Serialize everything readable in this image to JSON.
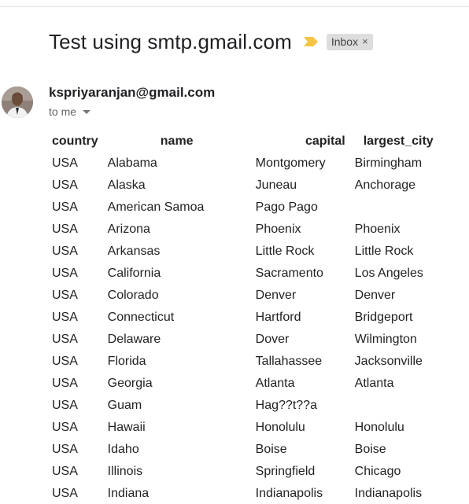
{
  "email": {
    "subject": "Test using smtp.gmail.com",
    "label": "Inbox",
    "label_remove": "×",
    "sender": "kspriyaranjan@gmail.com",
    "recipient": "to me"
  },
  "icons": {
    "importance": "importance-marker-icon",
    "caret": "chevron-down-icon",
    "avatar": "avatar"
  },
  "colors": {
    "importance": "#f4c542",
    "chip": "#dddddd"
  },
  "table": {
    "headers": [
      "country",
      "name",
      "capital",
      "largest_city"
    ],
    "rows": [
      [
        "USA",
        "Alabama",
        "Montgomery",
        "Birmingham"
      ],
      [
        "USA",
        "Alaska",
        "Juneau",
        "Anchorage"
      ],
      [
        "USA",
        "American Samoa",
        "Pago Pago",
        ""
      ],
      [
        "USA",
        "Arizona",
        "Phoenix",
        "Phoenix"
      ],
      [
        "USA",
        "Arkansas",
        "Little Rock",
        "Little Rock"
      ],
      [
        "USA",
        "California",
        "Sacramento",
        "Los Angeles"
      ],
      [
        "USA",
        "Colorado",
        "Denver",
        "Denver"
      ],
      [
        "USA",
        "Connecticut",
        "Hartford",
        "Bridgeport"
      ],
      [
        "USA",
        "Delaware",
        "Dover",
        "Wilmington"
      ],
      [
        "USA",
        "Florida",
        "Tallahassee",
        "Jacksonville"
      ],
      [
        "USA",
        "Georgia",
        "Atlanta",
        "Atlanta"
      ],
      [
        "USA",
        "Guam",
        "Hag??t??a",
        ""
      ],
      [
        "USA",
        "Hawaii",
        "Honolulu",
        "Honolulu"
      ],
      [
        "USA",
        "Idaho",
        "Boise",
        "Boise"
      ],
      [
        "USA",
        "Illinois",
        "Springfield",
        "Chicago"
      ],
      [
        "USA",
        "Indiana",
        "Indianapolis",
        "Indianapolis"
      ]
    ]
  }
}
